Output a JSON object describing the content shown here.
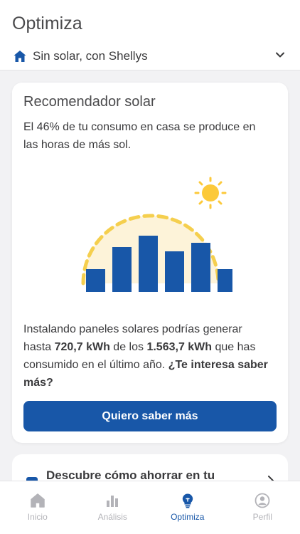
{
  "header": {
    "title": "Optimiza",
    "home_selector": "Sin solar, con Shellys"
  },
  "solar_card": {
    "title": "Recomendador solar",
    "intro": "El 46% de tu consumo en casa se produce en las horas de más sol.",
    "body_part1": "Instalando paneles solares podrías generar hasta ",
    "body_bold1": "720,7 kWh",
    "body_part2": " de los ",
    "body_bold2": "1.563,7 kWh",
    "body_part3": " que has consumido en el último año. ",
    "body_bold3": "¿Te interesa saber más?",
    "cta_label": "Quiero saber más"
  },
  "tip_card": {
    "title": "Descubre cómo ahorrar en tu"
  },
  "tabs": [
    {
      "label": "Inicio",
      "icon": "home-icon",
      "active": false
    },
    {
      "label": "Análisis",
      "icon": "chart-icon",
      "active": false
    },
    {
      "label": "Optimiza",
      "icon": "lightbulb-icon",
      "active": true
    },
    {
      "label": "Perfil",
      "icon": "user-icon",
      "active": false
    }
  ],
  "colors": {
    "accent": "#1857a8",
    "sun": "#fcc93a",
    "arc": "#f5cf4e",
    "glow": "#fdf3d9",
    "inactive": "#b3b3b8"
  }
}
